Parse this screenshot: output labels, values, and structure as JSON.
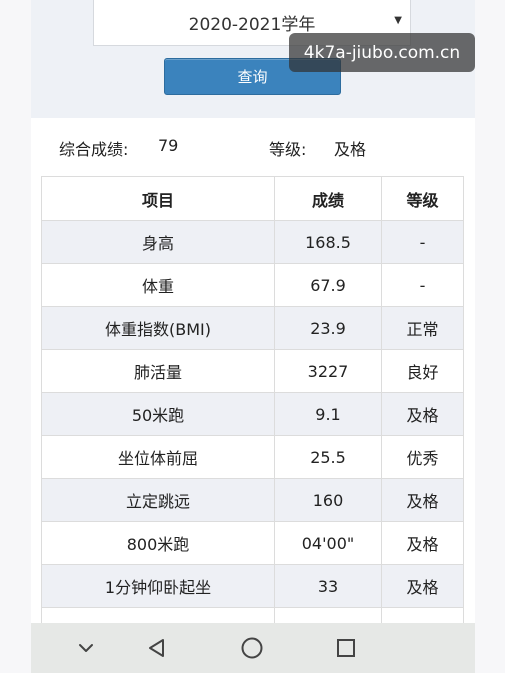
{
  "filter": {
    "year_value": "2020-2021学年",
    "query_label": "查询"
  },
  "watermark": "4k7a-jiubo.com.cn",
  "summary": {
    "composite_label": "综合成绩:",
    "composite_value": "79",
    "grade_label": "等级:",
    "grade_value": "及格"
  },
  "table": {
    "headers": [
      "项目",
      "成绩",
      "等级"
    ],
    "rows": [
      [
        "身高",
        "168.5",
        "-"
      ],
      [
        "体重",
        "67.9",
        "-"
      ],
      [
        "体重指数(BMI)",
        "23.9",
        "正常"
      ],
      [
        "肺活量",
        "3227",
        "良好"
      ],
      [
        "50米跑",
        "9.1",
        "及格"
      ],
      [
        "坐位体前屈",
        "25.5",
        "优秀"
      ],
      [
        "立定跳远",
        "160",
        "及格"
      ],
      [
        "800米跑",
        "04'00\"",
        "及格"
      ],
      [
        "1分钟仰卧起坐",
        "33",
        "及格"
      ]
    ]
  },
  "nav": {
    "icons": [
      "chevron-down-icon",
      "back-triangle-icon",
      "home-circle-icon",
      "recents-square-icon"
    ]
  },
  "colors": {
    "query_button": "#3b83bd",
    "panel_bg": "#eef1f6",
    "nav_bg": "#e6e8e6"
  }
}
